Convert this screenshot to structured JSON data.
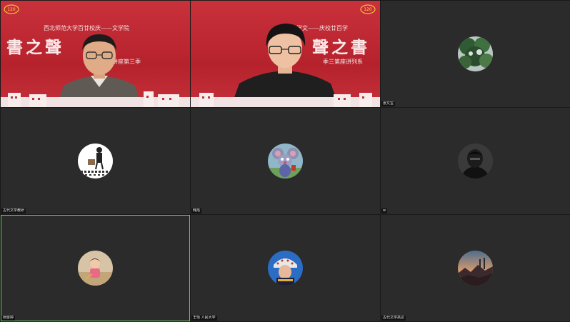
{
  "meeting": {
    "banner": {
      "header_left": "西北师范大学百廿校庆——文学院",
      "title_left": "書之聲",
      "series_left": "系列讲座第三季",
      "header_right": "院学文——庆校廿百学",
      "title_right": "聲之書",
      "series_right": "季三第座讲列系"
    },
    "participants": [
      {
        "name": "",
        "kind": "video-left"
      },
      {
        "name": "",
        "kind": "video-right"
      },
      {
        "name": "张文宝",
        "avatar_icon": "tree-canopy-icon"
      },
      {
        "name": "古代文学教研",
        "avatar_icon": "calligraphy-figure-icon"
      },
      {
        "name": "韩焰",
        "avatar_icon": "cartoon-mouse-icon"
      },
      {
        "name": "w",
        "avatar_icon": "masked-person-icon"
      },
      {
        "name": "杨俊婷",
        "avatar_icon": "child-photo-icon",
        "active_speaker": true
      },
      {
        "name": "王怡 人民大学",
        "avatar_icon": "ethnic-headdress-icon"
      },
      {
        "name": "古代文学高达",
        "avatar_icon": "sunset-landscape-icon"
      }
    ]
  },
  "colors": {
    "tile_bg": "#2b2b2b",
    "banner_red": "#c4313a",
    "active_border": "#6fc36a"
  }
}
